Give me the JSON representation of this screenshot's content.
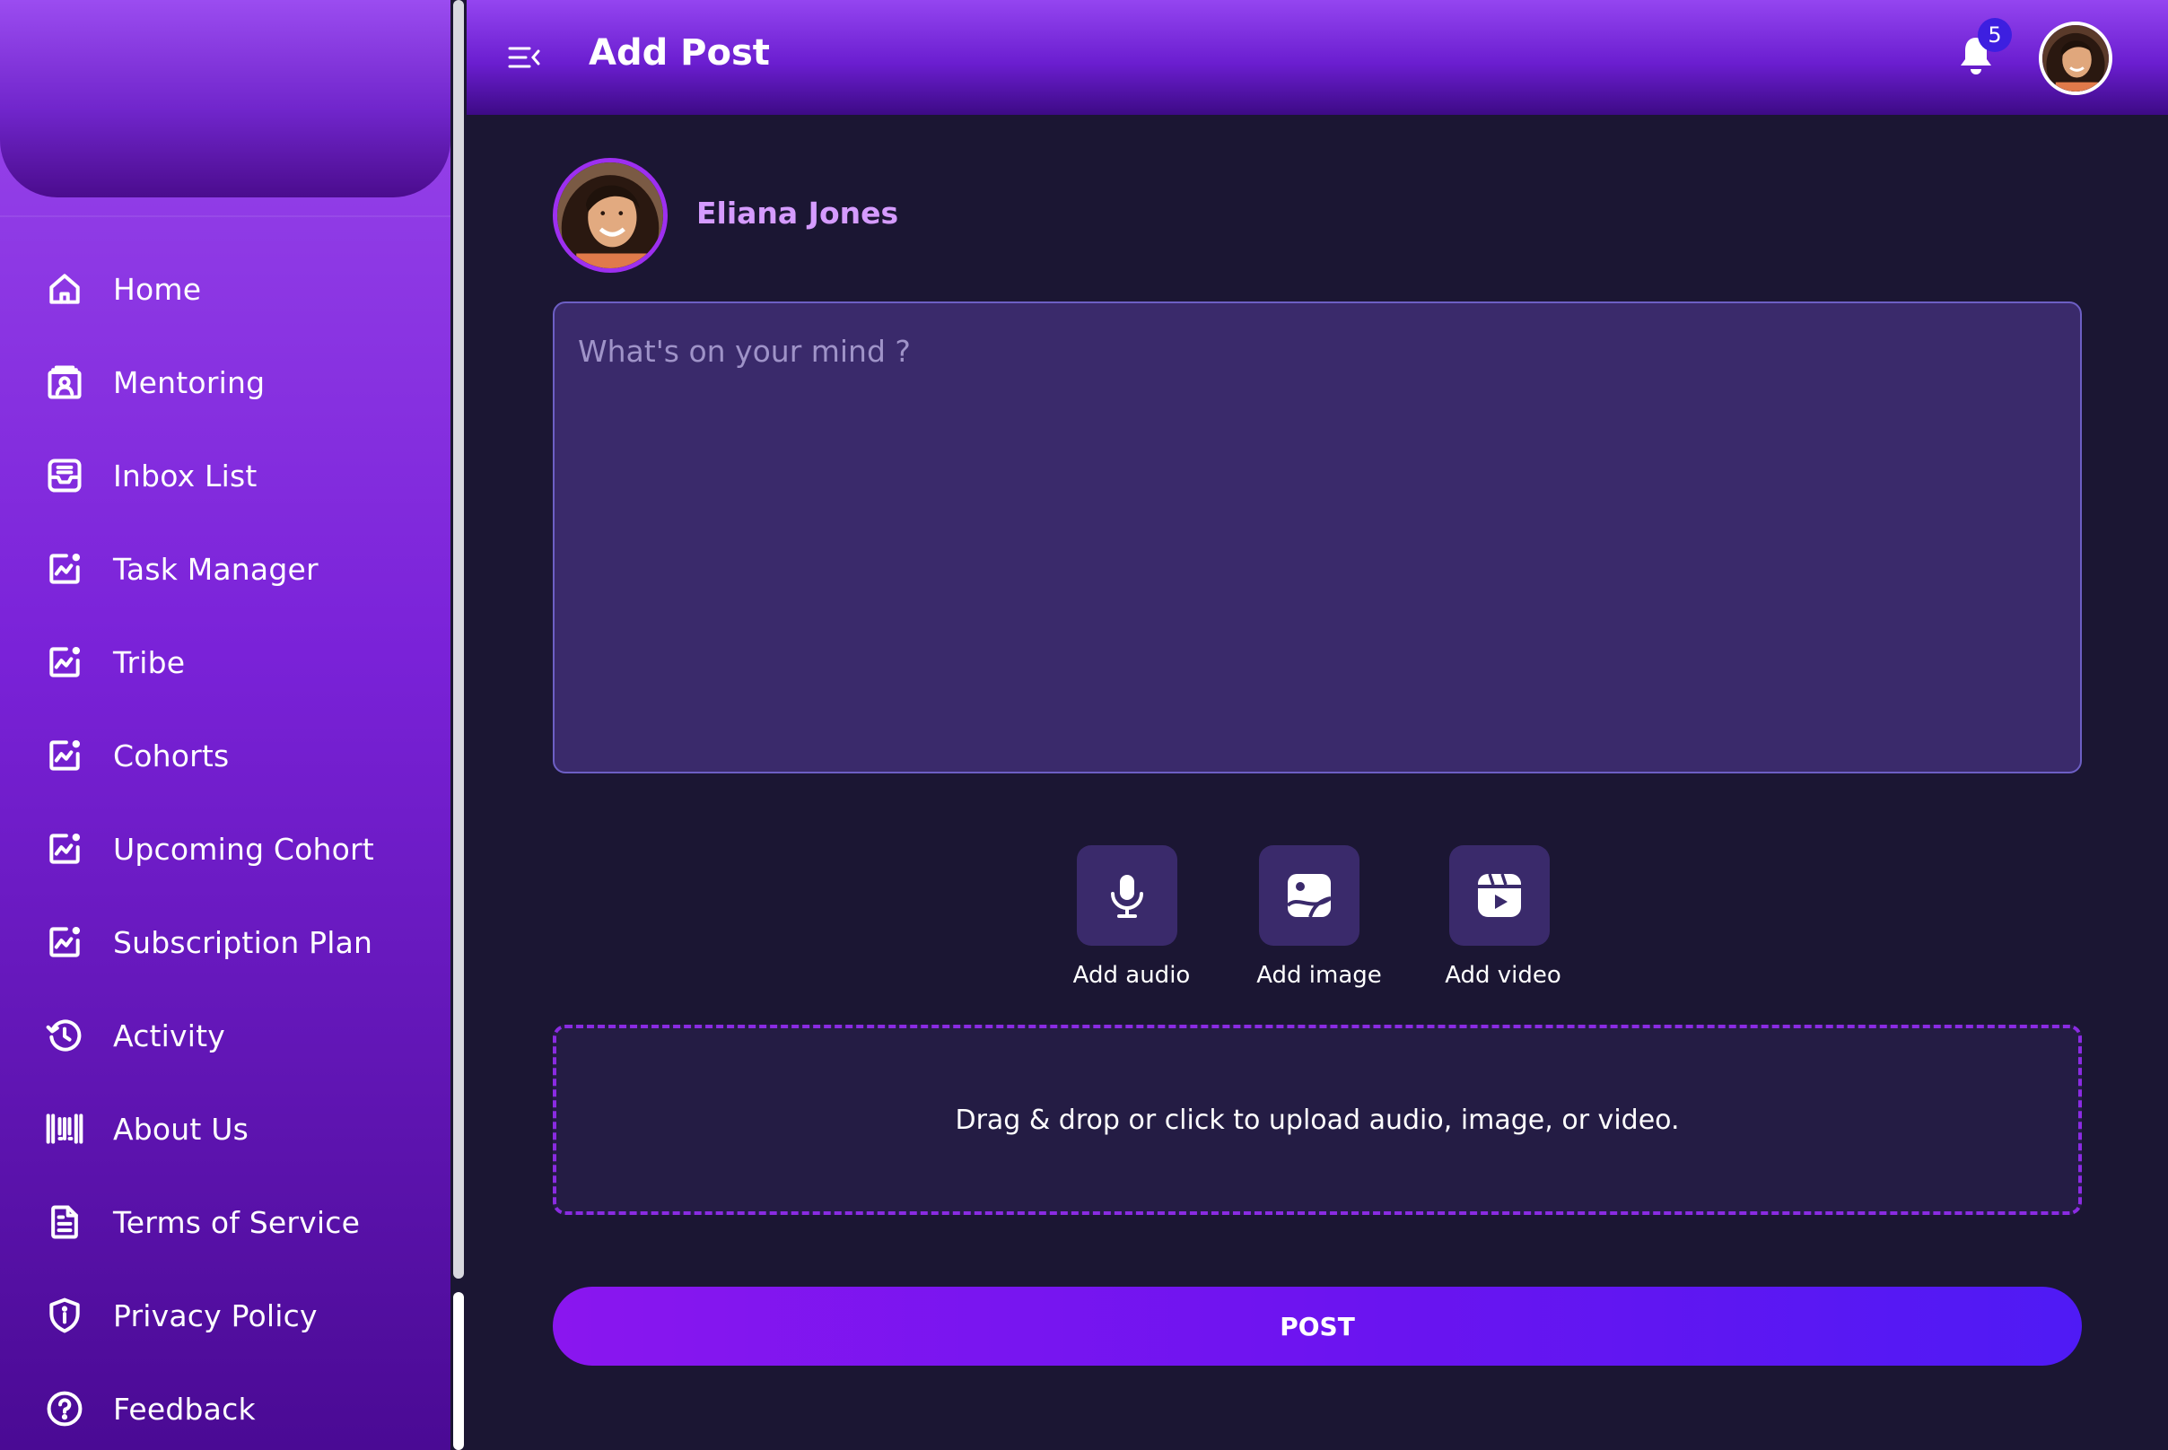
{
  "sidebar": {
    "items": [
      {
        "label": "Home",
        "icon": "home-icon"
      },
      {
        "label": "Mentoring",
        "icon": "mentoring-icon"
      },
      {
        "label": "Inbox List",
        "icon": "inbox-icon"
      },
      {
        "label": "Task Manager",
        "icon": "chart-icon"
      },
      {
        "label": "Tribe",
        "icon": "chart-icon"
      },
      {
        "label": "Cohorts",
        "icon": "chart-icon"
      },
      {
        "label": "Upcoming Cohort",
        "icon": "chart-icon"
      },
      {
        "label": "Subscription Plan",
        "icon": "chart-icon"
      },
      {
        "label": "Activity",
        "icon": "history-icon"
      },
      {
        "label": "About Us",
        "icon": "barcode-icon"
      },
      {
        "label": "Terms of Service",
        "icon": "document-icon"
      },
      {
        "label": "Privacy Policy",
        "icon": "shield-icon"
      },
      {
        "label": "Feedback",
        "icon": "help-icon"
      }
    ]
  },
  "header": {
    "title": "Add Post",
    "notification_count": "5"
  },
  "composer": {
    "user_name": "Eliana Jones",
    "placeholder": "What's on your mind ?",
    "add_audio": "Add audio",
    "add_image": "Add image",
    "add_video": "Add video",
    "dropzone_text": "Drag & drop or click to upload audio, image, or video.",
    "post_label": "POST"
  },
  "colors": {
    "accent": "#8a16ef",
    "background": "#1b1633",
    "username": "#d59bff"
  }
}
